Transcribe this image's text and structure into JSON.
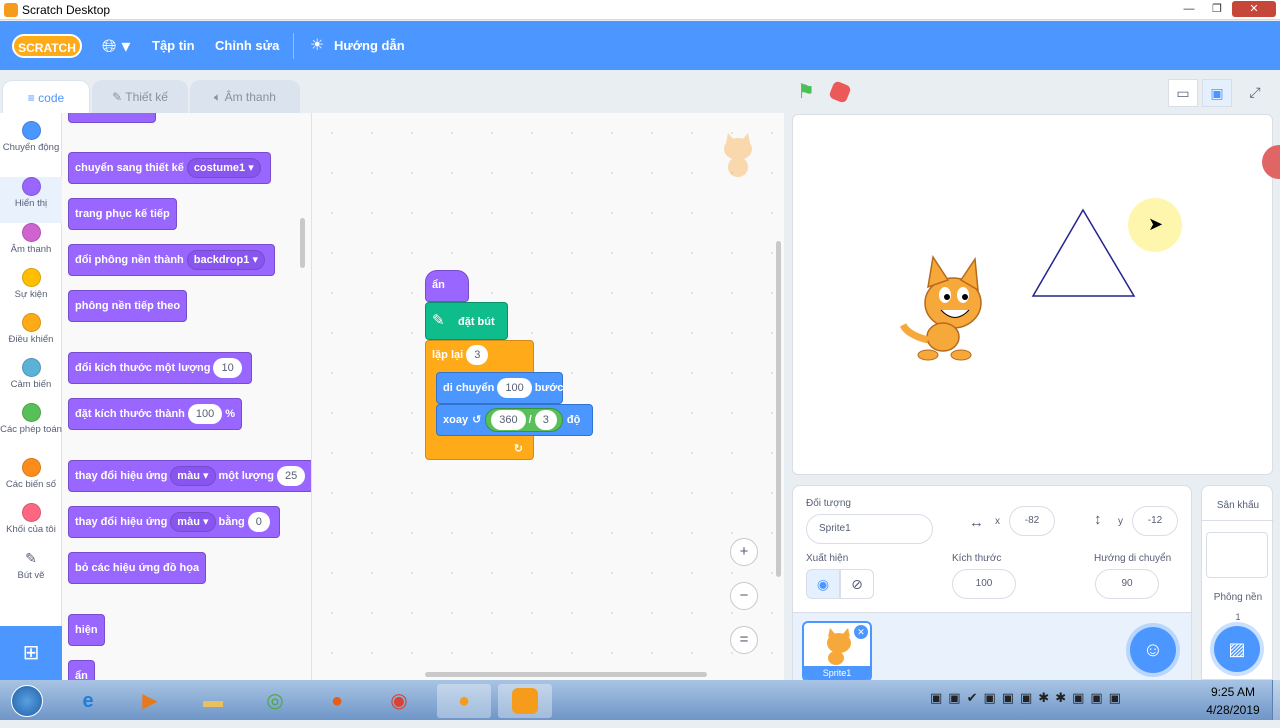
{
  "window": {
    "title": "Scratch Desktop",
    "minimize": "—",
    "restore": "❐",
    "close": "✕"
  },
  "menubar": {
    "logo": "SCRATCH",
    "file": "Tập tin",
    "edit": "Chỉnh sửa",
    "tutorials": "Hướng dẫn"
  },
  "tabs": {
    "code": "code",
    "costumes": "Thiết kế",
    "sounds": "Âm thanh"
  },
  "categories": [
    {
      "label": "Chuyển động",
      "color": "#4c97ff"
    },
    {
      "label": "Hiển thị",
      "color": "#9966ff"
    },
    {
      "label": "Âm thanh",
      "color": "#cf63cf"
    },
    {
      "label": "Sự kiện",
      "color": "#ffbf00"
    },
    {
      "label": "Điều khiển",
      "color": "#ffab19"
    },
    {
      "label": "Cảm biến",
      "color": "#5cb1d6"
    },
    {
      "label": "Các phép toán",
      "color": "#59c059"
    },
    {
      "label": "Các biến số",
      "color": "#ff8c1a"
    },
    {
      "label": "Khối của tôi",
      "color": "#ff6680"
    },
    {
      "label": "Bút vẽ",
      "color": "#0fbd8c"
    }
  ],
  "palette": {
    "switch_costume": "chuyển sang thiết kế",
    "costume_value": "costume1",
    "next_costume": "trang phục kế tiếp",
    "switch_backdrop": "đổi phông nền thành",
    "backdrop_value": "backdrop1",
    "next_backdrop": "phông nền tiếp theo",
    "change_size": "đổi kích thước một lượng",
    "change_size_value": "10",
    "set_size": "đặt kích thước thành",
    "set_size_value": "100",
    "percent": "%",
    "change_effect": "thay đổi hiệu ứng",
    "effect_value": "màu",
    "by_amount": "một lượng",
    "change_effect_value": "25",
    "set_effect": "thay đổi hiệu ứng",
    "to_label": "bằng",
    "set_effect_value": "0",
    "clear_effects": "bỏ các hiệu ứng đồ họa",
    "show": "hiện",
    "hide": "ẩn"
  },
  "script": {
    "hide": "ẩn",
    "pen_down": "đặt bút",
    "repeat": "lặp lại",
    "repeat_count": "3",
    "move": "di chuyển",
    "move_steps": "100",
    "steps": "bước",
    "turn": "xoay",
    "turn_a": "360",
    "div": "/",
    "turn_b": "3",
    "degrees": "độ",
    "loop_arrow": "↻"
  },
  "zoom": {
    "in": "+",
    "out": "−",
    "reset": "="
  },
  "sprite_info": {
    "sprite_label": "Đối tượng",
    "sprite_name": "Sprite1",
    "x_label": "x",
    "x_value": "-82",
    "y_label": "y",
    "y_value": "-12",
    "show_label": "Xuất hiện",
    "size_label": "Kích thước",
    "size_value": "100",
    "direction_label": "Hướng di chuyển",
    "direction_value": "90",
    "thumb_name": "Sprite1"
  },
  "stage_panel": {
    "title": "Sân khấu",
    "backdrops_label": "Phông nền",
    "backdrops_count": "1"
  },
  "taskbar": {
    "time": "9:25 AM",
    "date": "4/28/2019"
  }
}
